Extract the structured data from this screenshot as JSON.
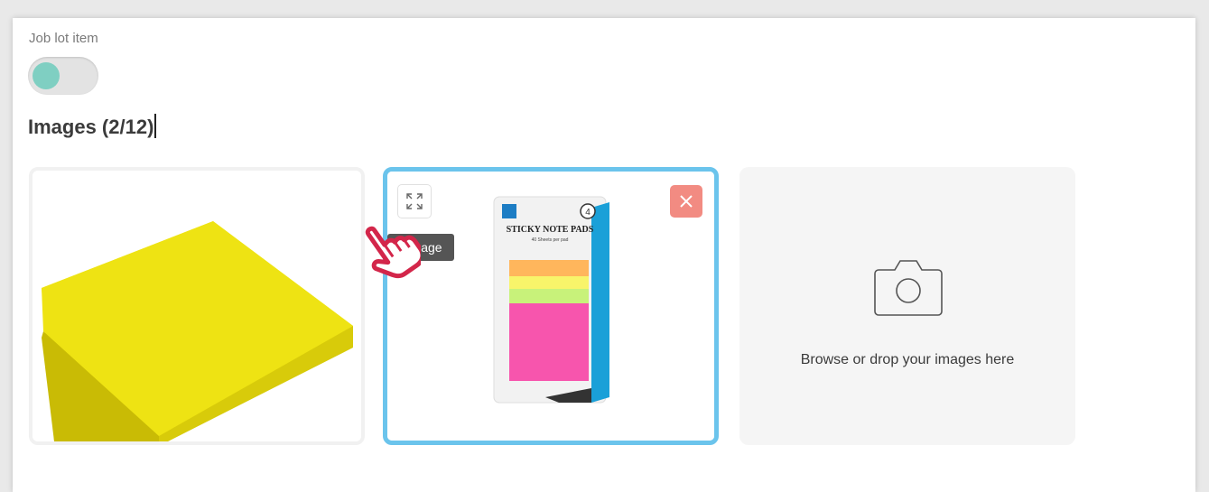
{
  "job_lot": {
    "label": "Job lot item",
    "toggle_state": "off"
  },
  "images": {
    "title": "Images (2/12)",
    "cards": [
      {
        "kind": "image",
        "alt": "yellow sticky note pad"
      },
      {
        "kind": "image",
        "alt": "sticky note pads package",
        "package_text": "STICKY NOTE PADS",
        "package_sub": "40 Sheets per pad",
        "package_badge": "4"
      }
    ],
    "tooltip": "e Image",
    "drop_zone_text": "Browse or drop your images here"
  },
  "colors": {
    "accent_border": "#6bc4ec",
    "toggle_knob": "#7fcfc2",
    "close_button": "#f28b82",
    "cursor": "#d3264a"
  },
  "icons": {
    "expand": "expand-icon",
    "close": "close-icon",
    "camera": "camera-icon",
    "cursor": "pointer-hand-icon"
  }
}
